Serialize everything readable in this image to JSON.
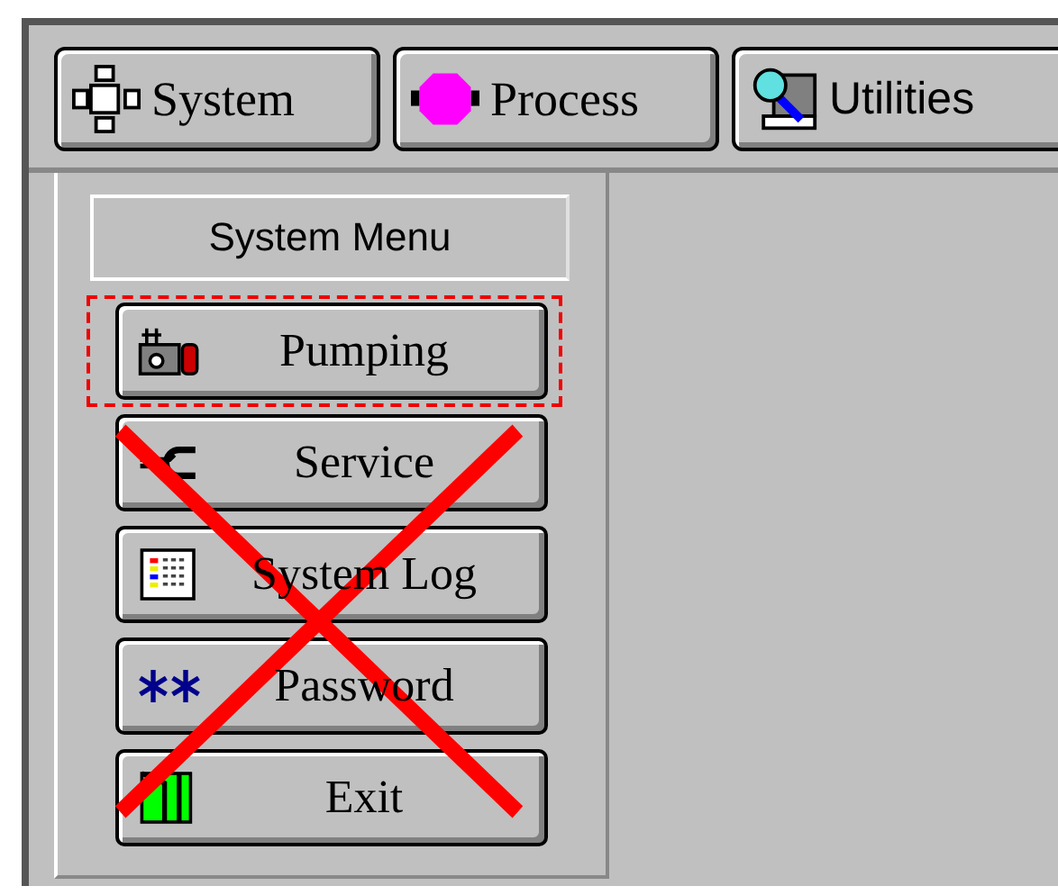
{
  "tabs": [
    {
      "label": "System",
      "kind": "system"
    },
    {
      "label": "Process",
      "kind": "process"
    },
    {
      "label": "Utilities",
      "kind": "utilities"
    }
  ],
  "menu": {
    "title": "System Menu",
    "crossed_out": true,
    "items": [
      {
        "label": "Pumping",
        "kind": "pump",
        "selected": true
      },
      {
        "label": "Service",
        "kind": "wrench",
        "selected": false
      },
      {
        "label": "System Log",
        "kind": "log",
        "selected": false
      },
      {
        "label": "Password",
        "kind": "password",
        "selected": false
      },
      {
        "label": "Exit",
        "kind": "exit",
        "selected": false
      }
    ]
  }
}
